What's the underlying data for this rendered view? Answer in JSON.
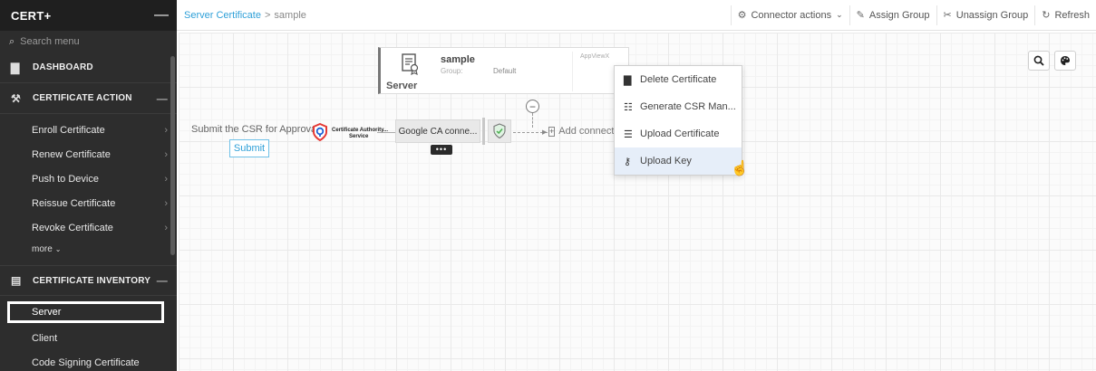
{
  "sidebar": {
    "brand": "CERT+",
    "collapse_icon": "minus-icon",
    "search_placeholder": "Search menu",
    "dashboard": "DASHBOARD",
    "certificate_action": {
      "title": "CERTIFICATE ACTION",
      "items": [
        "Enroll Certificate",
        "Renew Certificate",
        "Push to Device",
        "Reissue Certificate",
        "Revoke Certificate"
      ],
      "more": "more"
    },
    "certificate_inventory": {
      "title": "CERTIFICATE INVENTORY",
      "items": [
        "Server",
        "Client",
        "Code Signing Certificate"
      ]
    }
  },
  "breadcrumb": {
    "link": "Server Certificate",
    "separator": ">",
    "current": "sample"
  },
  "toolbar": {
    "connector_actions": "Connector actions",
    "assign_group": "Assign Group",
    "unassign_group": "Unassign Group",
    "refresh": "Refresh"
  },
  "card": {
    "name": "sample",
    "group_label": "Group:",
    "group_value": "Default",
    "brand": "AppViewX",
    "type": "Server"
  },
  "workflow": {
    "submit_text": "Submit the CSR for Approval.",
    "submit_button": "Submit",
    "ca_title": "Certificate Authority...",
    "ca_subtitle": "Service",
    "connector": "Google CA conne...",
    "more_dots": "•••",
    "add_connector": "Add connector"
  },
  "context_menu": {
    "items": [
      {
        "label": "Delete Certificate",
        "icon": "trash-icon"
      },
      {
        "label": "Generate CSR Man...",
        "icon": "csr-icon"
      },
      {
        "label": "Upload Certificate",
        "icon": "upload-certificate-icon"
      },
      {
        "label": "Upload Key",
        "icon": "key-icon"
      }
    ]
  },
  "colors": {
    "accent": "#2fa0d8",
    "sidebar_bg": "#2d2d2d",
    "menu_highlight": "#e6eef9"
  }
}
